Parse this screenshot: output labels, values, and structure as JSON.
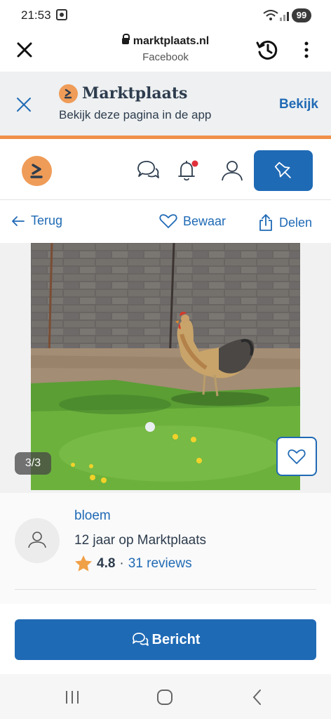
{
  "status_bar": {
    "time": "21:53",
    "battery": "99",
    "icons": [
      "screenshot-icon",
      "wifi-icon",
      "signal-icon",
      "battery-icon"
    ]
  },
  "browser": {
    "url": "marktplaats.nl",
    "subtitle": "Facebook",
    "icons": [
      "close-icon",
      "lock-icon",
      "history-icon",
      "more-icon"
    ]
  },
  "app_banner": {
    "brand": "Marktplaats",
    "text": "Bekijk deze pagina in de app",
    "action": "Bekijk"
  },
  "header": {
    "icons": [
      "marktplaats-logo",
      "messages-icon",
      "notifications-icon",
      "profile-icon",
      "place-ad-icon"
    ],
    "notification_dot_color": "#e0303a"
  },
  "nav": {
    "back": "Terug",
    "save": "Bewaar",
    "share": "Delen"
  },
  "listing": {
    "photo_counter": "3/3"
  },
  "seller": {
    "name": "bloem",
    "member_since": "12 jaar op Marktplaats",
    "rating": "4.8",
    "separator": "·",
    "reviews": "31 reviews"
  },
  "actions": {
    "message": "Bericht"
  },
  "colors": {
    "brand_blue": "#1f6ab5",
    "brand_orange": "#ef9c58",
    "text_dark": "#2d3c4d"
  }
}
